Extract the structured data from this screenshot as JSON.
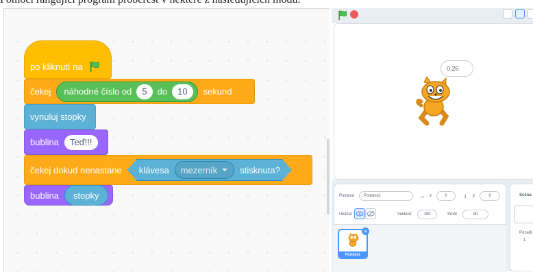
{
  "intro_text": "Pomocí rangující program proberest v nektere z nasledujicich modu.",
  "script": {
    "when_flag_clicked": "po kliknutí na",
    "wait_label": "čekej",
    "random_label": "náhodné číslo od",
    "random_from": "5",
    "random_to_label": "do",
    "random_to": "10",
    "seconds_label": "sekund",
    "reset_timer": "vynuluj stopky",
    "say_label": "bublina",
    "say_text": "Teď!!!",
    "wait_until_label": "čekej dokud nenastane",
    "key_label": "klávesa",
    "key_option": "mezerník",
    "pressed_label": "stisknuta?",
    "say2_label": "bublina",
    "timer_reporter": "stopky"
  },
  "stage": {
    "speech_value": "0.26"
  },
  "sprite_info": {
    "sprite_label": "Postava",
    "sprite_name": "Postava1",
    "x_label": "x",
    "x_value": "0",
    "y_label": "y",
    "y_value": "0",
    "show_label": "Ukázat",
    "size_label": "Velikost",
    "size_value": "100",
    "direction_label": "Směr",
    "direction_value": "90",
    "stage_label": "Scéna",
    "backdrops_label": "Pozadí",
    "backdrops_count": "1",
    "card_name": "Postava1"
  },
  "colors": {
    "events": "#ffbf00",
    "control": "#ffab19",
    "operators": "#59c059",
    "sensing": "#5cb1d6",
    "looks": "#9966ff",
    "accent": "#4c97ff"
  },
  "icons": [
    "green-flag-icon",
    "stop-icon",
    "dropdown-arrow-icon",
    "eye-icon",
    "eye-off-icon",
    "trash-icon",
    "cat-sprite"
  ]
}
